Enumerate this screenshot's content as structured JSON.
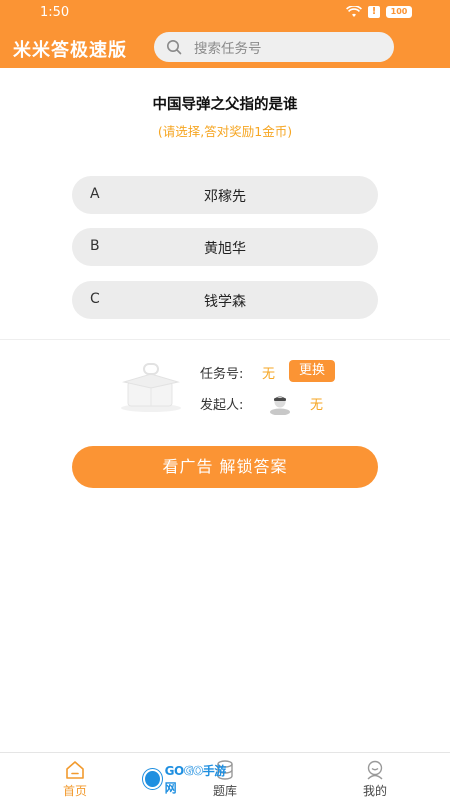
{
  "status_bar": {
    "time": "1:50",
    "battery": "100",
    "icons": [
      "wifi-icon",
      "alert-icon",
      "battery-icon"
    ]
  },
  "header": {
    "app_title": "米米答极速版",
    "search_placeholder": "搜索任务号"
  },
  "question": {
    "title": "中国导弹之父指的是谁",
    "hint": "(请选择,答对奖励1金币)"
  },
  "options": [
    {
      "letter": "A",
      "text": "邓稼先"
    },
    {
      "letter": "B",
      "text": "黄旭华"
    },
    {
      "letter": "C",
      "text": "钱学森"
    }
  ],
  "task_info": {
    "task_no_label": "任务号:",
    "task_no_value": "无",
    "swap_label": "更换",
    "initiator_label": "发起人:",
    "initiator_value": "无"
  },
  "unlock_button": "看广告 解锁答案",
  "bottom_nav": [
    {
      "label": "首页",
      "icon": "home-icon",
      "active": true
    },
    {
      "label": "题库",
      "icon": "question-bank-icon",
      "active": false
    },
    {
      "label": "我的",
      "icon": "profile-icon",
      "active": false
    }
  ],
  "watermark": {
    "text_a": "GO",
    "text_b": "GO",
    "text_c": "手游网"
  },
  "colors": {
    "accent": "#fb9434",
    "hint": "#f6a623",
    "option_bg": "#ececec",
    "search_bg": "#efefef"
  }
}
